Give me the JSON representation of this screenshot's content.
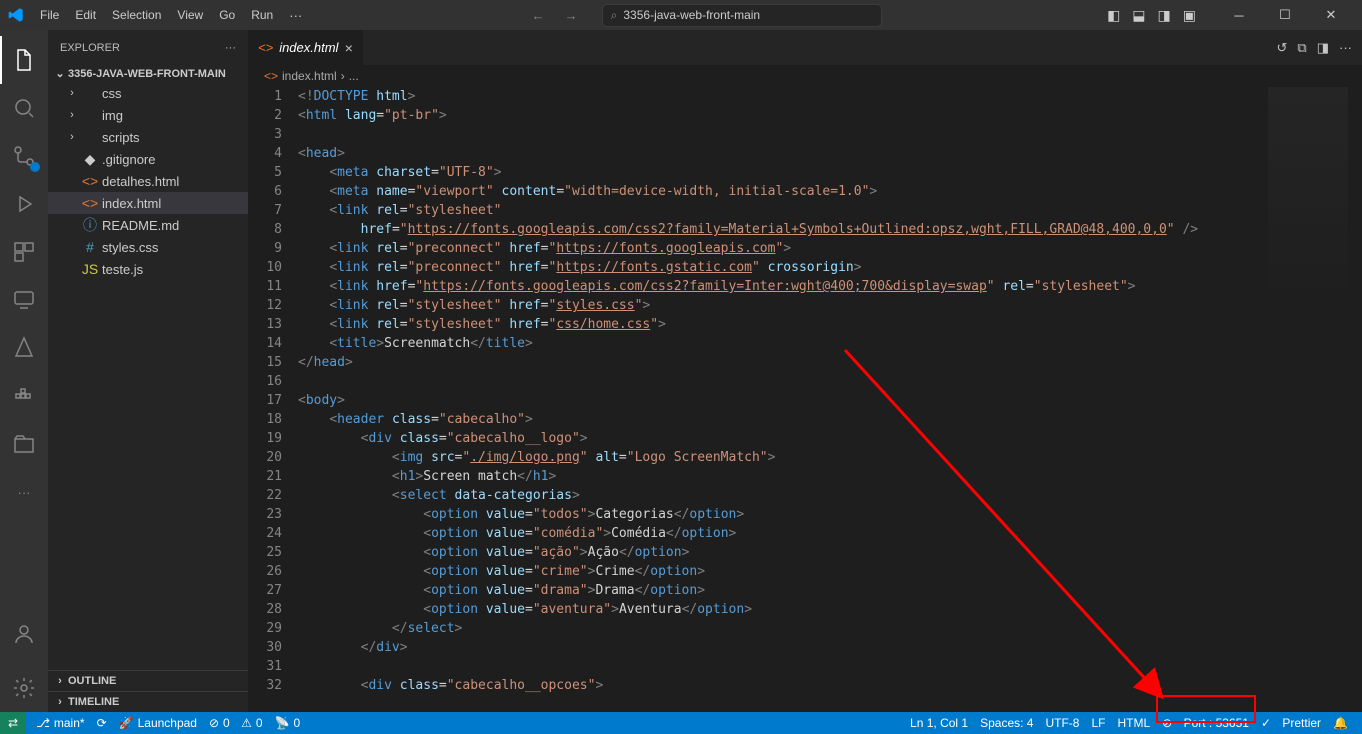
{
  "titlebar": {
    "menus": [
      "File",
      "Edit",
      "Selection",
      "View",
      "Go",
      "Run"
    ],
    "search_text": "3356-java-web-front-main"
  },
  "sidebar": {
    "title": "EXPLORER",
    "project": "3356-JAVA-WEB-FRONT-MAIN",
    "items": [
      {
        "icon": "chev",
        "label": "css",
        "indent": 1,
        "folder": true
      },
      {
        "icon": "chev",
        "label": "img",
        "indent": 1,
        "folder": true
      },
      {
        "icon": "chev",
        "label": "scripts",
        "indent": 1,
        "folder": true
      },
      {
        "icon": "git",
        "label": ".gitignore",
        "indent": 1,
        "color": "#cccccc"
      },
      {
        "icon": "html",
        "label": "detalhes.html",
        "indent": 1,
        "color": "#e37933"
      },
      {
        "icon": "html",
        "label": "index.html",
        "indent": 1,
        "selected": true,
        "color": "#e37933"
      },
      {
        "icon": "info",
        "label": "README.md",
        "indent": 1,
        "color": "#519aba"
      },
      {
        "icon": "css",
        "label": "styles.css",
        "indent": 1,
        "color": "#519aba"
      },
      {
        "icon": "js",
        "label": "teste.js",
        "indent": 1,
        "color": "#cbcb41"
      }
    ],
    "outline": "OUTLINE",
    "timeline": "TIMELINE"
  },
  "tab": {
    "label": "index.html"
  },
  "breadcrumbs": {
    "file": "index.html",
    "sep": "›",
    "dots": "..."
  },
  "code_lines": [
    {
      "n": 1,
      "html": "<span class='t-gray'>&lt;!</span><span class='t-blue'>DOCTYPE</span> <span class='t-lblue'>html</span><span class='t-gray'>&gt;</span>"
    },
    {
      "n": 2,
      "html": "<span class='t-gray'>&lt;</span><span class='t-blue'>html</span> <span class='t-lblue'>lang</span>=<span class='t-orange'>\"pt-br\"</span><span class='t-gray'>&gt;</span>"
    },
    {
      "n": 3,
      "html": ""
    },
    {
      "n": 4,
      "html": "<span class='t-gray'>&lt;</span><span class='t-blue'>head</span><span class='t-gray'>&gt;</span>"
    },
    {
      "n": 5,
      "html": "    <span class='t-gray'>&lt;</span><span class='t-blue'>meta</span> <span class='t-lblue'>charset</span>=<span class='t-orange'>\"UTF-8\"</span><span class='t-gray'>&gt;</span>"
    },
    {
      "n": 6,
      "html": "    <span class='t-gray'>&lt;</span><span class='t-blue'>meta</span> <span class='t-lblue'>name</span>=<span class='t-orange'>\"viewport\"</span> <span class='t-lblue'>content</span>=<span class='t-orange'>\"width=device-width, initial-scale=1.0\"</span><span class='t-gray'>&gt;</span>"
    },
    {
      "n": 7,
      "html": "    <span class='t-gray'>&lt;</span><span class='t-blue'>link</span> <span class='t-lblue'>rel</span>=<span class='t-orange'>\"stylesheet\"</span>"
    },
    {
      "n": 8,
      "html": "        <span class='t-lblue'>href</span>=<span class='t-orange'>\"<span class='link-underline'>https://fonts.googleapis.com/css2?family=Material+Symbols+Outlined:opsz,wght,FILL,GRAD@48,400,0,0</span>\"</span> <span class='t-gray'>/&gt;</span>"
    },
    {
      "n": 9,
      "html": "    <span class='t-gray'>&lt;</span><span class='t-blue'>link</span> <span class='t-lblue'>rel</span>=<span class='t-orange'>\"preconnect\"</span> <span class='t-lblue'>href</span>=<span class='t-orange'>\"<span class='link-underline'>https://fonts.googleapis.com</span>\"</span><span class='t-gray'>&gt;</span>"
    },
    {
      "n": 10,
      "html": "    <span class='t-gray'>&lt;</span><span class='t-blue'>link</span> <span class='t-lblue'>rel</span>=<span class='t-orange'>\"preconnect\"</span> <span class='t-lblue'>href</span>=<span class='t-orange'>\"<span class='link-underline'>https://fonts.gstatic.com</span>\"</span> <span class='t-lblue'>crossorigin</span><span class='t-gray'>&gt;</span>"
    },
    {
      "n": 11,
      "html": "    <span class='t-gray'>&lt;</span><span class='t-blue'>link</span> <span class='t-lblue'>href</span>=<span class='t-orange'>\"<span class='link-underline'>https://fonts.googleapis.com/css2?family=Inter:wght@400;700&amp;display=swap</span>\"</span> <span class='t-lblue'>rel</span>=<span class='t-orange'>\"stylesheet\"</span><span class='t-gray'>&gt;</span>"
    },
    {
      "n": 12,
      "html": "    <span class='t-gray'>&lt;</span><span class='t-blue'>link</span> <span class='t-lblue'>rel</span>=<span class='t-orange'>\"stylesheet\"</span> <span class='t-lblue'>href</span>=<span class='t-orange'>\"<span class='link-underline'>styles.css</span>\"</span><span class='t-gray'>&gt;</span>"
    },
    {
      "n": 13,
      "html": "    <span class='t-gray'>&lt;</span><span class='t-blue'>link</span> <span class='t-lblue'>rel</span>=<span class='t-orange'>\"stylesheet\"</span> <span class='t-lblue'>href</span>=<span class='t-orange'>\"<span class='link-underline'>css/home.css</span>\"</span><span class='t-gray'>&gt;</span>"
    },
    {
      "n": 14,
      "html": "    <span class='t-gray'>&lt;</span><span class='t-blue'>title</span><span class='t-gray'>&gt;</span>Screenmatch<span class='t-gray'>&lt;/</span><span class='t-blue'>title</span><span class='t-gray'>&gt;</span>"
    },
    {
      "n": 15,
      "html": "<span class='t-gray'>&lt;/</span><span class='t-blue'>head</span><span class='t-gray'>&gt;</span>"
    },
    {
      "n": 16,
      "html": ""
    },
    {
      "n": 17,
      "html": "<span class='t-gray'>&lt;</span><span class='t-blue'>body</span><span class='t-gray'>&gt;</span>"
    },
    {
      "n": 18,
      "html": "    <span class='t-gray'>&lt;</span><span class='t-blue'>header</span> <span class='t-lblue'>class</span>=<span class='t-orange'>\"cabecalho\"</span><span class='t-gray'>&gt;</span>"
    },
    {
      "n": 19,
      "html": "        <span class='t-gray'>&lt;</span><span class='t-blue'>div</span> <span class='t-lblue'>class</span>=<span class='t-orange'>\"cabecalho__logo\"</span><span class='t-gray'>&gt;</span>"
    },
    {
      "n": 20,
      "html": "            <span class='t-gray'>&lt;</span><span class='t-blue'>img</span> <span class='t-lblue'>src</span>=<span class='t-orange'>\"<span class='link-underline'>./img/logo.png</span>\"</span> <span class='t-lblue'>alt</span>=<span class='t-orange'>\"Logo ScreenMatch\"</span><span class='t-gray'>&gt;</span>"
    },
    {
      "n": 21,
      "html": "            <span class='t-gray'>&lt;</span><span class='t-blue'>h1</span><span class='t-gray'>&gt;</span>Screen match<span class='t-gray'>&lt;/</span><span class='t-blue'>h1</span><span class='t-gray'>&gt;</span>"
    },
    {
      "n": 22,
      "html": "            <span class='t-gray'>&lt;</span><span class='t-blue'>select</span> <span class='t-lblue'>data-categorias</span><span class='t-gray'>&gt;</span>"
    },
    {
      "n": 23,
      "html": "                <span class='t-gray'>&lt;</span><span class='t-blue'>option</span> <span class='t-lblue'>value</span>=<span class='t-orange'>\"todos\"</span><span class='t-gray'>&gt;</span>Categorias<span class='t-gray'>&lt;/</span><span class='t-blue'>option</span><span class='t-gray'>&gt;</span>"
    },
    {
      "n": 24,
      "html": "                <span class='t-gray'>&lt;</span><span class='t-blue'>option</span> <span class='t-lblue'>value</span>=<span class='t-orange'>\"comédia\"</span><span class='t-gray'>&gt;</span>Comédia<span class='t-gray'>&lt;/</span><span class='t-blue'>option</span><span class='t-gray'>&gt;</span>"
    },
    {
      "n": 25,
      "html": "                <span class='t-gray'>&lt;</span><span class='t-blue'>option</span> <span class='t-lblue'>value</span>=<span class='t-orange'>\"ação\"</span><span class='t-gray'>&gt;</span>Ação<span class='t-gray'>&lt;/</span><span class='t-blue'>option</span><span class='t-gray'>&gt;</span>"
    },
    {
      "n": 26,
      "html": "                <span class='t-gray'>&lt;</span><span class='t-blue'>option</span> <span class='t-lblue'>value</span>=<span class='t-orange'>\"crime\"</span><span class='t-gray'>&gt;</span>Crime<span class='t-gray'>&lt;/</span><span class='t-blue'>option</span><span class='t-gray'>&gt;</span>"
    },
    {
      "n": 27,
      "html": "                <span class='t-gray'>&lt;</span><span class='t-blue'>option</span> <span class='t-lblue'>value</span>=<span class='t-orange'>\"drama\"</span><span class='t-gray'>&gt;</span>Drama<span class='t-gray'>&lt;/</span><span class='t-blue'>option</span><span class='t-gray'>&gt;</span>"
    },
    {
      "n": 28,
      "html": "                <span class='t-gray'>&lt;</span><span class='t-blue'>option</span> <span class='t-lblue'>value</span>=<span class='t-orange'>\"aventura\"</span><span class='t-gray'>&gt;</span>Aventura<span class='t-gray'>&lt;/</span><span class='t-blue'>option</span><span class='t-gray'>&gt;</span>"
    },
    {
      "n": 29,
      "html": "            <span class='t-gray'>&lt;/</span><span class='t-blue'>select</span><span class='t-gray'>&gt;</span>"
    },
    {
      "n": 30,
      "html": "        <span class='t-gray'>&lt;/</span><span class='t-blue'>div</span><span class='t-gray'>&gt;</span>"
    },
    {
      "n": 31,
      "html": ""
    },
    {
      "n": 32,
      "html": "        <span class='t-gray'>&lt;</span><span class='t-blue'>div</span> <span class='t-lblue'>class</span>=<span class='t-orange'>\"cabecalho__opcoes\"</span><span class='t-gray'>&gt;</span>"
    }
  ],
  "status": {
    "branch": "main*",
    "launchpad": "Launchpad",
    "errors": "0",
    "warnings": "0",
    "radio": "0",
    "cursor": "Ln 1, Col 1",
    "spaces": "Spaces: 4",
    "encoding": "UTF-8",
    "eol": "LF",
    "lang": "HTML",
    "port": "Port : 53651",
    "prettier": "Prettier"
  }
}
